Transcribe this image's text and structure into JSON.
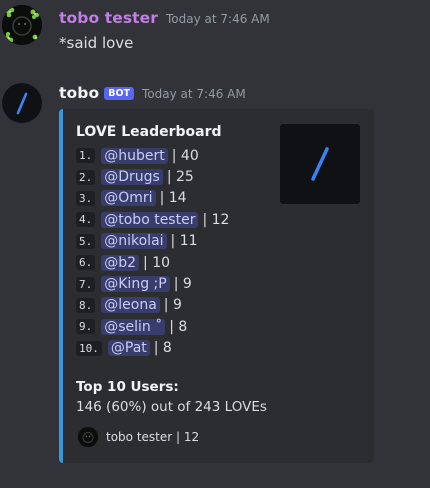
{
  "messages": [
    {
      "username": "tobo tester",
      "username_color": "#c27ee6",
      "timestamp": "Today at 7:46 AM",
      "content": "*said love"
    },
    {
      "username": "tobo",
      "bot_tag": "BOT",
      "timestamp": "Today at 7:46 AM"
    }
  ],
  "embed": {
    "accent_color": "#3a96dd",
    "title": "LOVE Leaderboard",
    "thumbnail_icon": "slash-logo-icon",
    "leaderboard": [
      {
        "rank": "1.",
        "user": "@hubert",
        "score": "| 40"
      },
      {
        "rank": "2.",
        "user": "@Drugs",
        "score": "| 25"
      },
      {
        "rank": "3.",
        "user": "@Omri",
        "score": "| 14"
      },
      {
        "rank": "4.",
        "user": "@tobo tester",
        "score": "| 12"
      },
      {
        "rank": "5.",
        "user": "@nikolai",
        "score": "| 11"
      },
      {
        "rank": "6.",
        "user": "@b2",
        "score": "| 10"
      },
      {
        "rank": "7.",
        "user": "@King ;P",
        "score": "| 9"
      },
      {
        "rank": "8.",
        "user": "@leona",
        "score": "| 9"
      },
      {
        "rank": "9.",
        "user": "@selin ˚",
        "score": "| 8"
      },
      {
        "rank": "10.",
        "user": "@Pat",
        "score": "| 8"
      }
    ],
    "field_name": "Top 10 Users:",
    "field_value": "146 (60%) out of 243 LOVEs",
    "footer_text": "tobo tester | 12"
  }
}
